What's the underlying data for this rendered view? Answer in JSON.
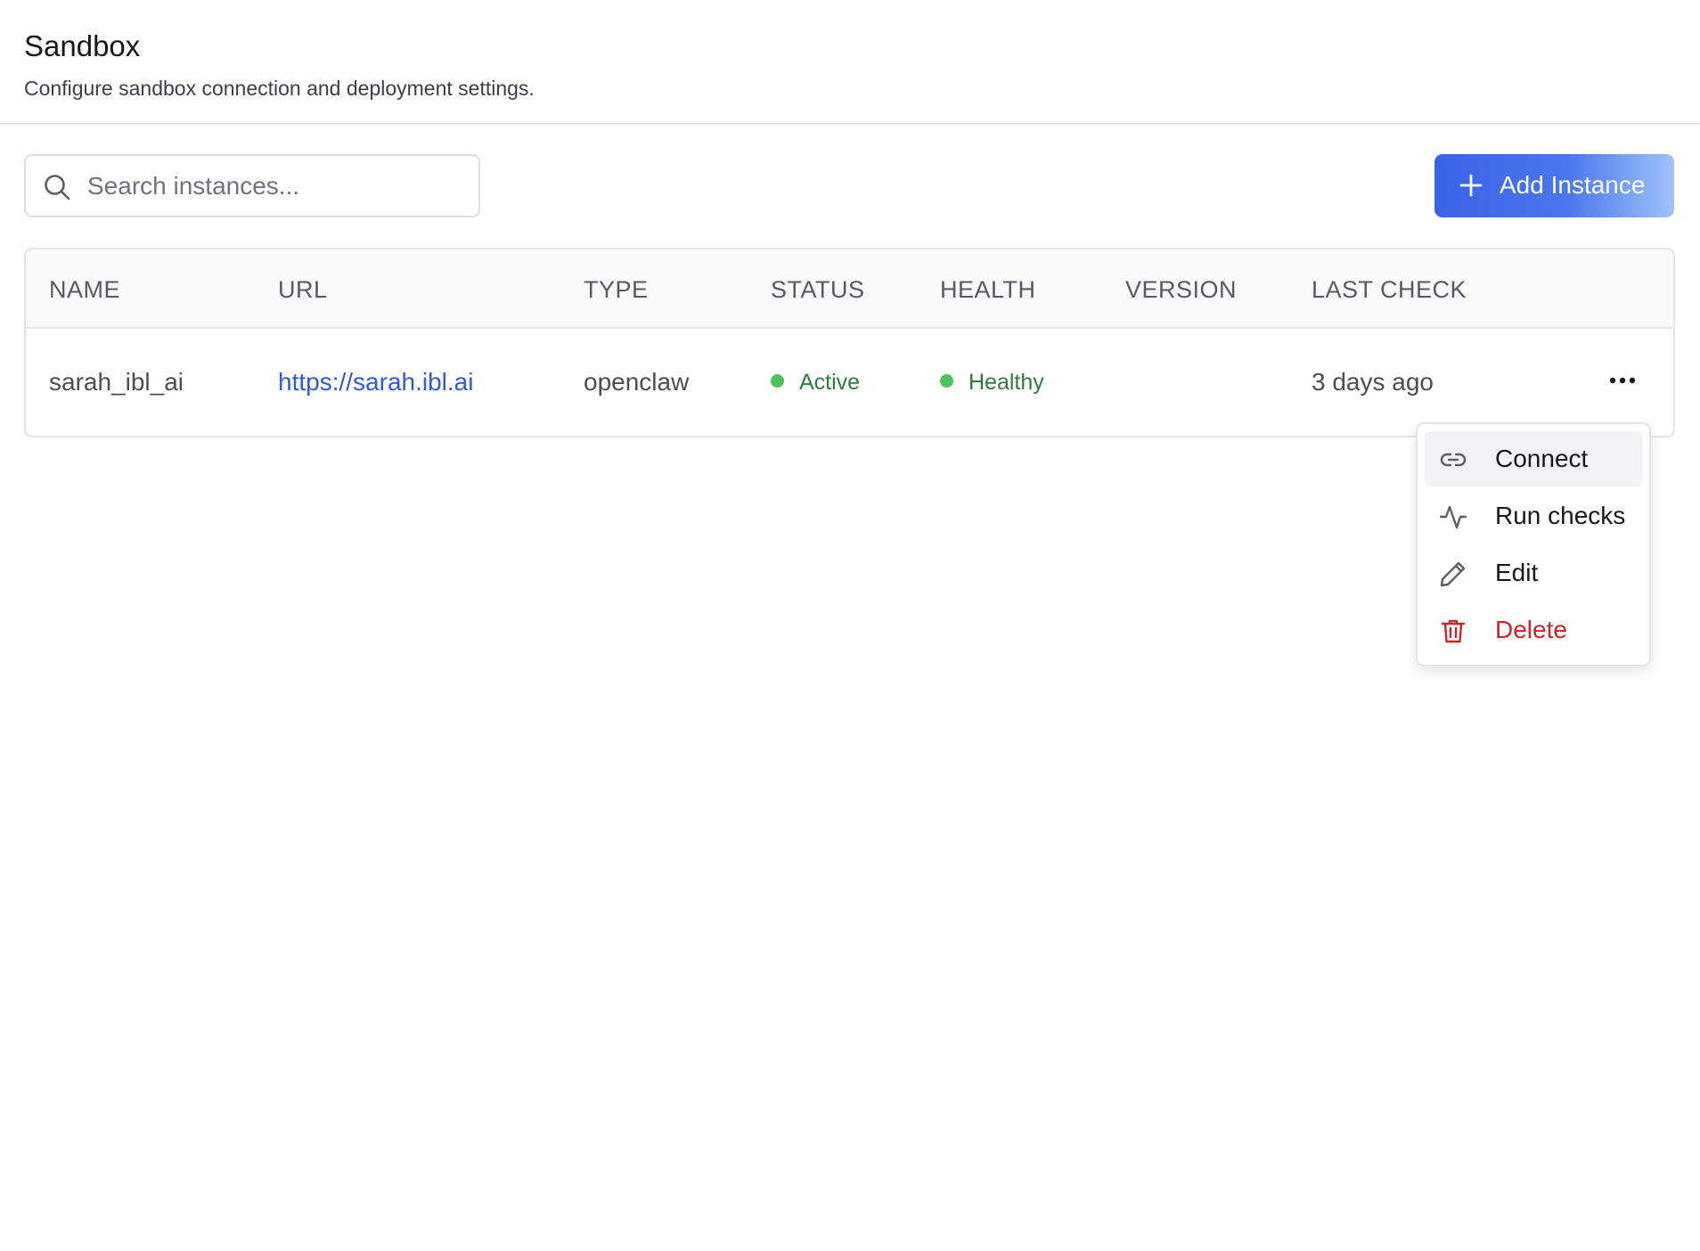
{
  "header": {
    "title": "Sandbox",
    "subtitle": "Configure sandbox connection and deployment settings."
  },
  "toolbar": {
    "search_placeholder": "Search instances...",
    "search_value": "",
    "search_icon": "search-icon",
    "add_label": "Add Instance",
    "add_icon": "plus-icon"
  },
  "table": {
    "columns": [
      "NAME",
      "URL",
      "TYPE",
      "STATUS",
      "HEALTH",
      "VERSION",
      "LAST CHECK"
    ],
    "rows": [
      {
        "name": "sarah_ibl_ai",
        "url": "https://sarah.ibl.ai",
        "type": "openclaw",
        "status": "Active",
        "health": "Healthy",
        "version": "",
        "last_check": "3 days ago"
      }
    ]
  },
  "row_menu": {
    "trigger_icon": "more-horizontal-icon",
    "items": [
      {
        "label": "Connect",
        "icon": "link-icon"
      },
      {
        "label": "Run checks",
        "icon": "activity-icon"
      },
      {
        "label": "Edit",
        "icon": "pencil-icon"
      },
      {
        "label": "Delete",
        "icon": "trash-icon"
      }
    ]
  },
  "colors": {
    "accent": "#3a63e6",
    "link": "#2f5bd3",
    "success_dot": "#4cc35a",
    "success_text": "#2c7f3a",
    "danger": "#c62828"
  }
}
